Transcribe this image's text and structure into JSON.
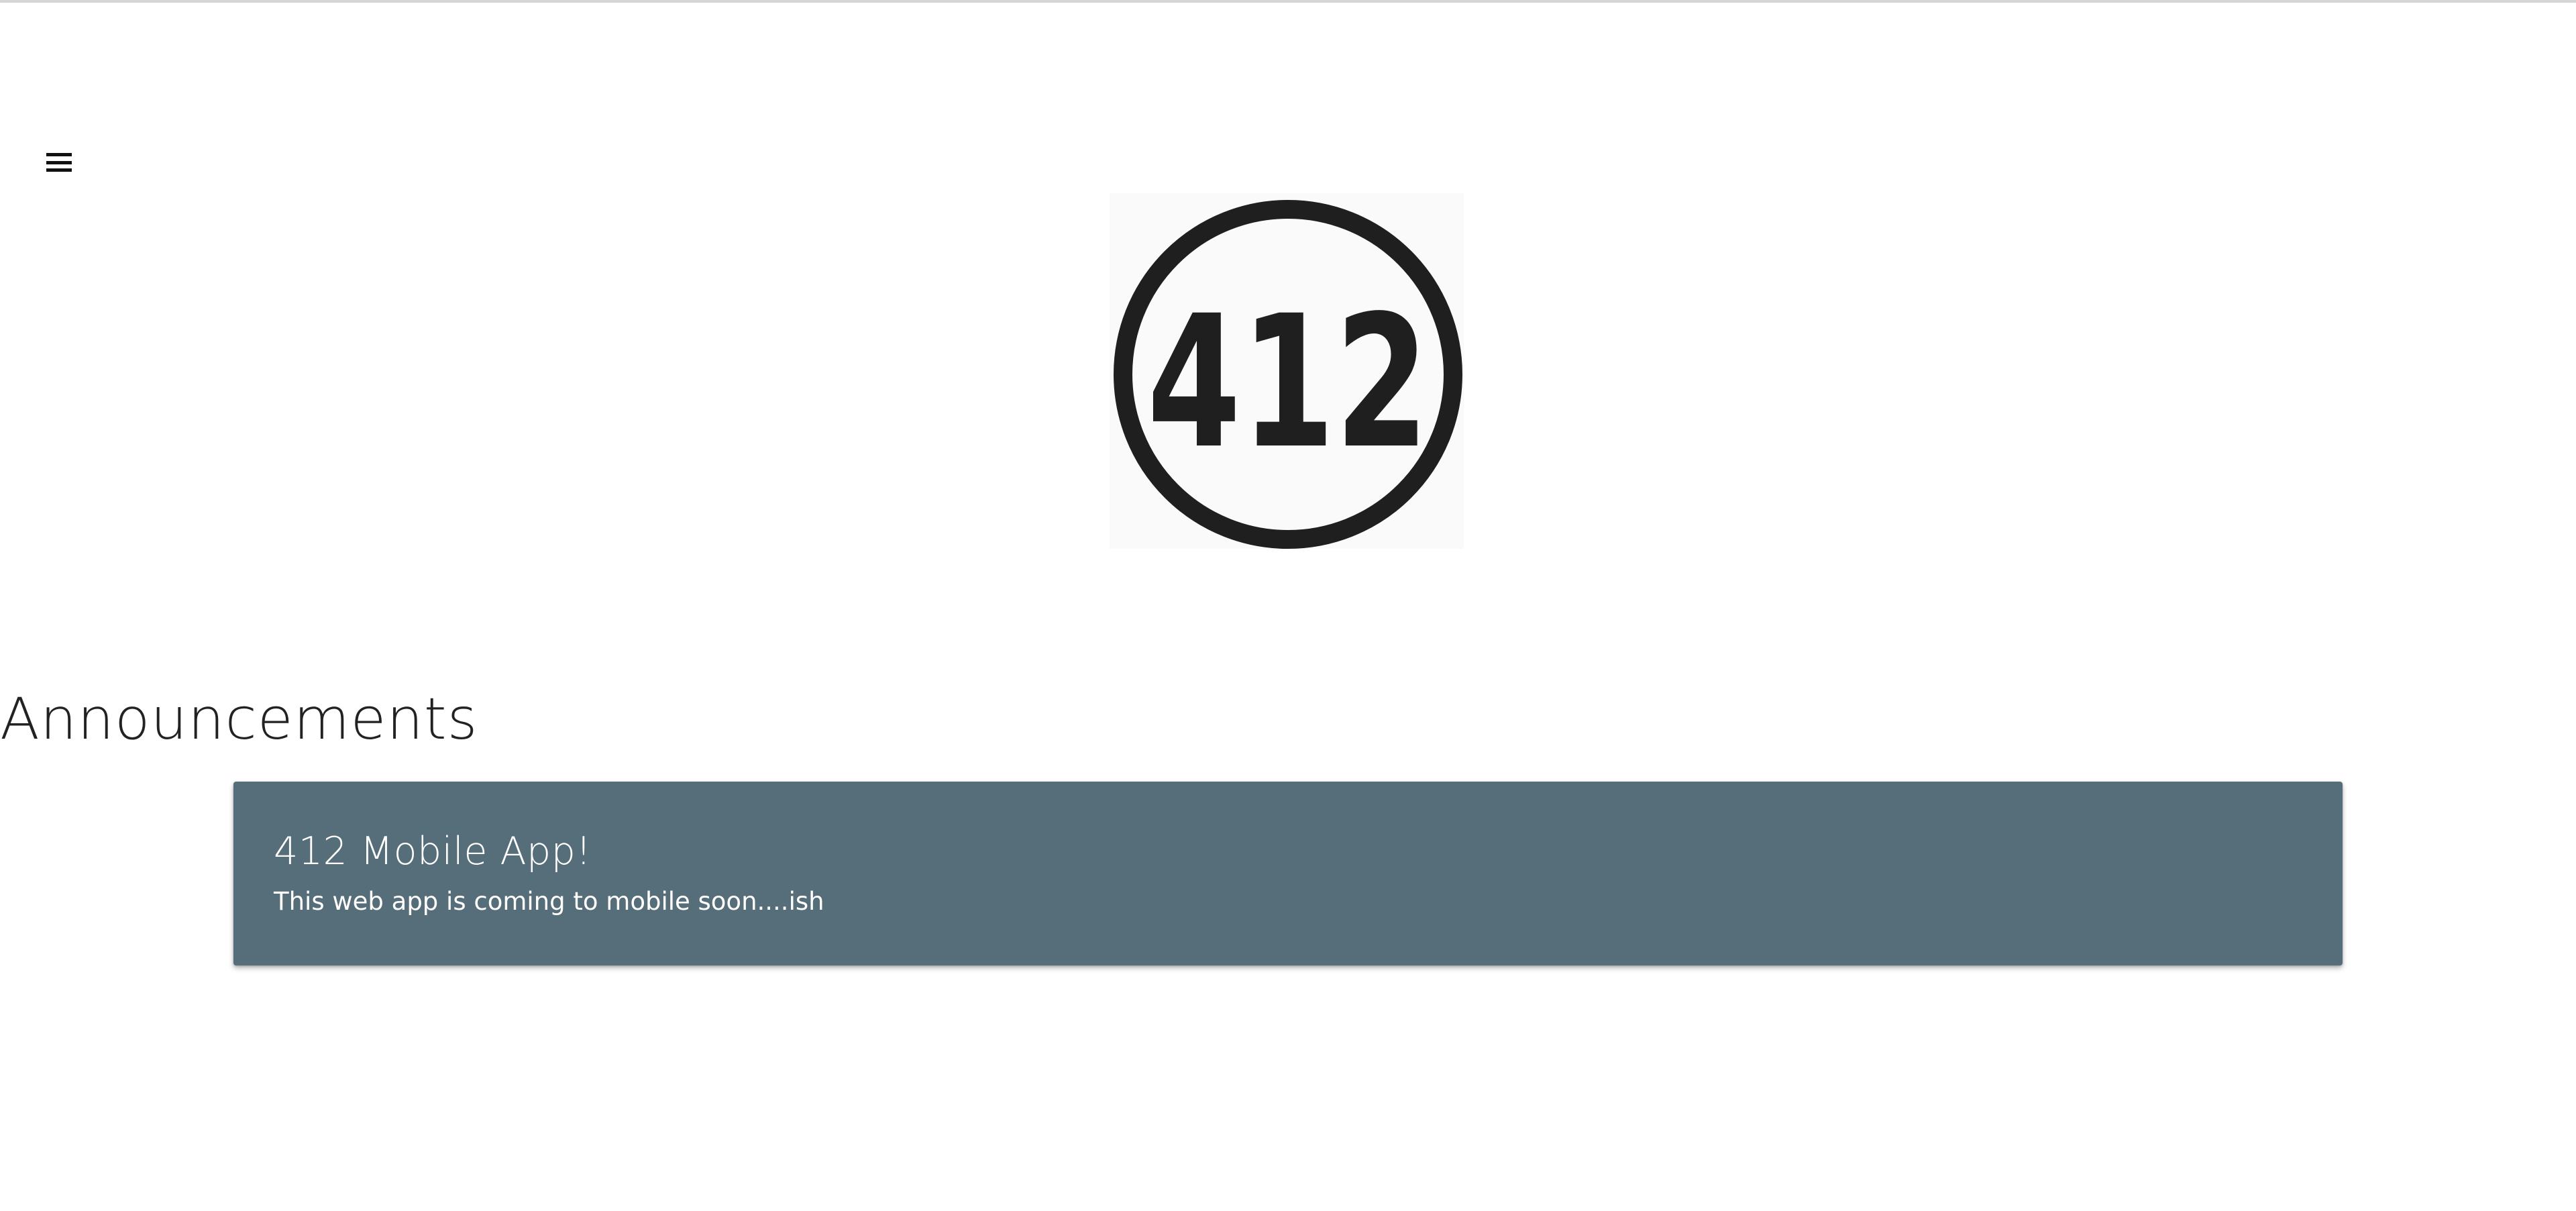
{
  "nav": {
    "menu_icon": "hamburger-menu-icon"
  },
  "logo": {
    "text": "412",
    "color": "#1f1f1f"
  },
  "announcements": {
    "heading": "Announcements",
    "card_color": "#566e7a",
    "items": [
      {
        "title": "412 Mobile App!",
        "body": "This web app is coming to mobile soon....ish"
      }
    ]
  }
}
